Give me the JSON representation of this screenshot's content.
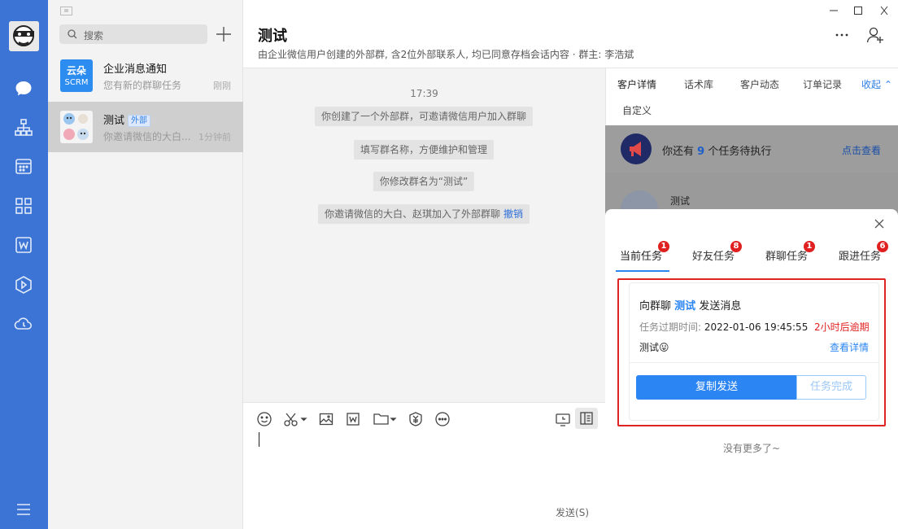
{
  "sidebar": {
    "search_placeholder": "搜索",
    "conversations": [
      {
        "name": "企业消息通知",
        "preview": "您有新的群聊任务",
        "time": "刚刚",
        "avatar_text_top": "云朵",
        "avatar_text_bottom": "SCRM"
      },
      {
        "name": "测试",
        "tag": "外部",
        "preview": "你邀请微信的大白...",
        "time": "1分钟前"
      }
    ]
  },
  "chat": {
    "title": "测试",
    "subtitle": "由企业微信用户创建的外部群, 含2位外部联系人, 均已同意存档会话内容  · 群主: 李浩斌",
    "time": "17:39",
    "system_messages": [
      {
        "text": "你创建了一个外部群，可邀请微信用户加入群聊"
      },
      {
        "text": "填写群名称，方便维护和管理"
      },
      {
        "text": "你修改群名为“测试”"
      },
      {
        "text": "你邀请微信的大白、赵琪加入了外部群聊",
        "link": "撤销"
      }
    ],
    "send_label": "发送(S)"
  },
  "right_panel": {
    "tabs": [
      "客户详情",
      "话术库",
      "客户动态",
      "订单记录"
    ],
    "collapse_label": "收起",
    "custom_tab": "自定义",
    "notice": {
      "prefix": "你还有",
      "count": "9",
      "suffix": "个任务待执行",
      "link": "点击查看"
    },
    "member_name": "测试"
  },
  "task_sheet": {
    "tabs": [
      {
        "label": "当前任务",
        "badge": "1"
      },
      {
        "label": "好友任务",
        "badge": "8"
      },
      {
        "label": "群聊任务",
        "badge": "1"
      },
      {
        "label": "跟进任务",
        "badge": "6"
      }
    ],
    "task": {
      "title_prefix": "向群聊",
      "group_name": "测试",
      "title_suffix": "发送消息",
      "expire_label": "任务过期时间:",
      "expire_time": "2022-01-06 19:45:55",
      "overdue": "2小时后逾期",
      "content": "测试😛",
      "detail_link": "查看详情",
      "copy_button": "复制发送",
      "done_button": "任务完成"
    },
    "no_more": "没有更多了~"
  },
  "colors": {
    "accent": "#2b86f3",
    "rail": "#3b74d4",
    "danger": "#e02020"
  }
}
